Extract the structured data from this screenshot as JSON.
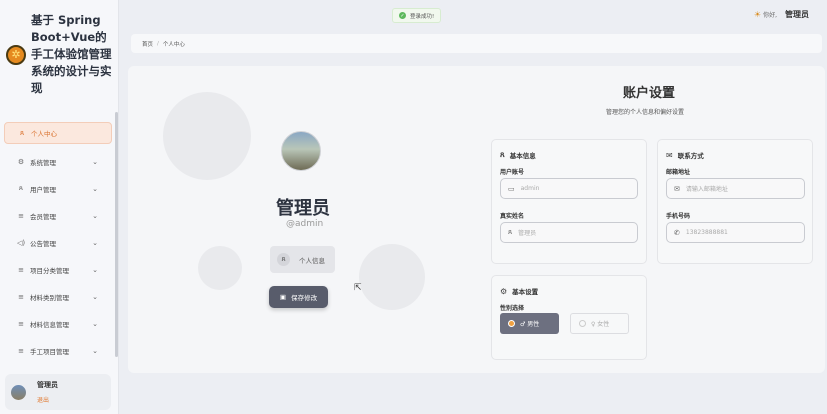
{
  "sidebar": {
    "brand_title": "基于 Spring Boot+Vue的手工体验馆管理系统的设计与实现",
    "items": [
      {
        "label": "个人中心",
        "icon": "person-icon",
        "glyph": "ጸ",
        "active": true,
        "chevron": ""
      },
      {
        "label": "系统管理",
        "icon": "gear-icon",
        "glyph": "⚙",
        "active": false,
        "chevron": "⌄"
      },
      {
        "label": "用户管理",
        "icon": "users-icon",
        "glyph": "ጰ",
        "active": false,
        "chevron": "⌄"
      },
      {
        "label": "会员管理",
        "icon": "list-icon",
        "glyph": "≡",
        "active": false,
        "chevron": "⌄"
      },
      {
        "label": "公告管理",
        "icon": "megaphone-icon",
        "glyph": "◁)",
        "active": false,
        "chevron": "⌄"
      },
      {
        "label": "项目分类管理",
        "icon": "list-icon",
        "glyph": "≡",
        "active": false,
        "chevron": "⌄"
      },
      {
        "label": "材料类别管理",
        "icon": "list-icon",
        "glyph": "≡",
        "active": false,
        "chevron": "⌄"
      },
      {
        "label": "材料信息管理",
        "icon": "list-icon",
        "glyph": "≡",
        "active": false,
        "chevron": "⌄"
      },
      {
        "label": "手工项目管理",
        "icon": "list-icon",
        "glyph": "≡",
        "active": false,
        "chevron": "⌄"
      }
    ],
    "user": {
      "name": "管理员",
      "logout": "退出"
    }
  },
  "header": {
    "toast": "登录成功!",
    "greeting": "你好,",
    "user_name": "管理员"
  },
  "breadcrumb": {
    "home": "首页",
    "separator": "/",
    "current": "个人中心"
  },
  "main": {
    "title": "账户设置",
    "subtitle": "管理您的个人信息和偏好设置",
    "profile": {
      "name": "管理员",
      "handle": "@admin",
      "personal_info_button": "个人信息",
      "save_button": "保存修改"
    },
    "basic_info": {
      "heading": "基本信息",
      "username_label": "用户账号",
      "username_value": "admin",
      "realname_label": "真实姓名",
      "realname_value": "管理员"
    },
    "contact": {
      "heading": "联系方式",
      "email_label": "邮箱地址",
      "email_placeholder": "请输入邮箱地址",
      "phone_label": "手机号码",
      "phone_value": "13823888881"
    },
    "basic_settings": {
      "heading": "基本设置",
      "gender_label": "性别选择",
      "male_label": "♂ 男性",
      "female_label": "♀ 女性",
      "selected": "男性"
    }
  },
  "colors": {
    "accent": "#e0782f",
    "primary_button": "#585c6b",
    "success": "#5cb85c"
  }
}
